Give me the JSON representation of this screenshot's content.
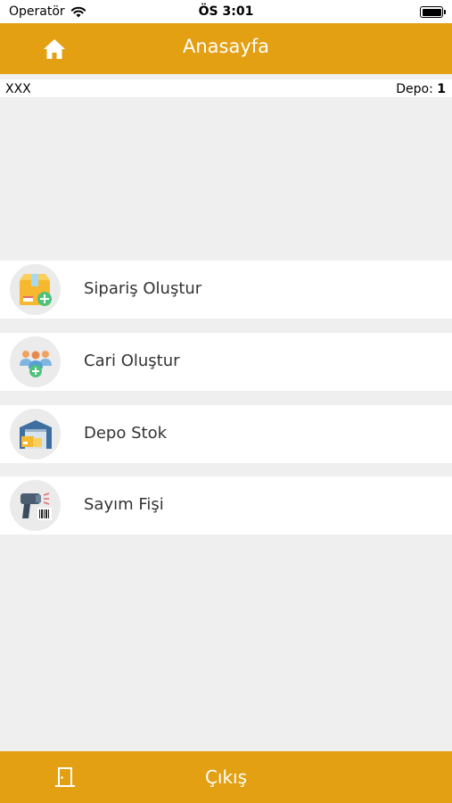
{
  "status_bar": {
    "carrier": "Operatör",
    "time": "ÖS 3:01"
  },
  "header": {
    "title": "Anasayfa",
    "home_icon": "home-icon"
  },
  "info_bar": {
    "left_text": "XXX",
    "depo_label": "Depo:",
    "depo_value": "1"
  },
  "menu": [
    {
      "label": "Sipariş Oluştur",
      "icon": "order-box-icon"
    },
    {
      "label": "Cari Oluştur",
      "icon": "add-people-icon"
    },
    {
      "label": "Depo Stok",
      "icon": "warehouse-icon"
    },
    {
      "label": "Sayım Fişi",
      "icon": "barcode-scanner-icon"
    }
  ],
  "footer": {
    "label": "Çıkış",
    "icon": "exit-door-icon"
  },
  "colors": {
    "accent": "#e2a012",
    "background": "#efefef"
  }
}
